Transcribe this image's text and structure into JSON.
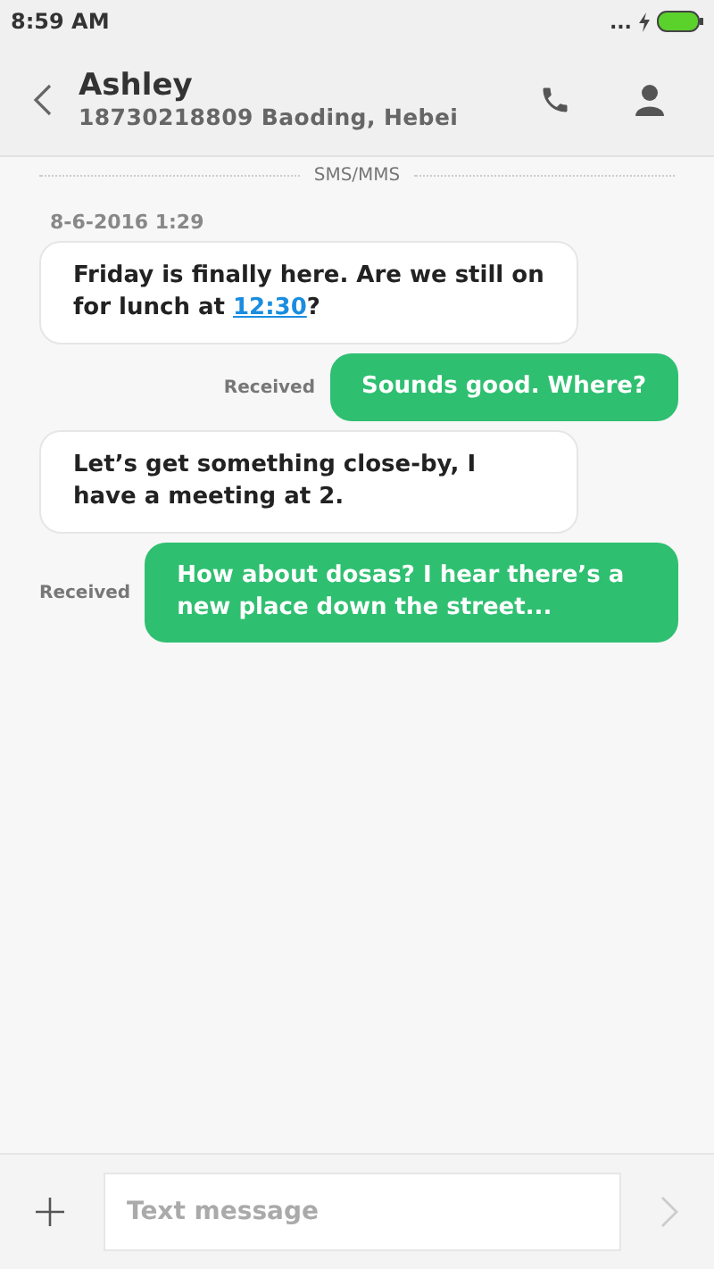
{
  "status_bar": {
    "time": "8:59 AM",
    "more": "...",
    "charging": true
  },
  "header": {
    "name": "Ashley",
    "subtitle": "18730218809 Baoding, Hebei"
  },
  "divider_label": "SMS/MMS",
  "timestamp": "8-6-2016 1:29",
  "messages": [
    {
      "kind": "incoming",
      "parts": [
        {
          "text": "Friday is finally here. Are we still on for lunch at ",
          "link": false
        },
        {
          "text": "12:30",
          "link": true
        },
        {
          "text": "?",
          "link": false
        }
      ]
    },
    {
      "kind": "outgoing",
      "status": "Received",
      "parts": [
        {
          "text": "Sounds good. Where?",
          "link": false
        }
      ]
    },
    {
      "kind": "incoming",
      "parts": [
        {
          "text": "Let’s get something close-by, I have a meeting at 2.",
          "link": false
        }
      ]
    },
    {
      "kind": "outgoing",
      "status": "Received",
      "parts": [
        {
          "text": "How about dosas? I hear there’s a new place down the street...",
          "link": false
        }
      ]
    }
  ],
  "composer": {
    "placeholder": "Text message",
    "send_disabled": true
  }
}
